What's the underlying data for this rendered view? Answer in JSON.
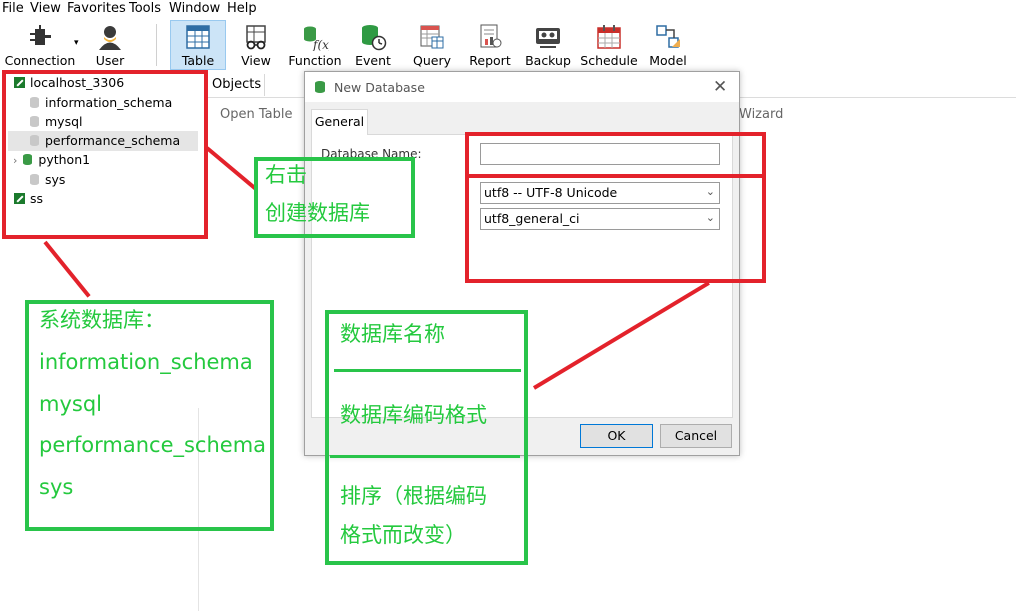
{
  "menu": [
    "File",
    "View",
    "Favorites",
    "Tools",
    "Window",
    "Help"
  ],
  "toolbar": [
    {
      "label": "Connection",
      "icon": "connection-icon"
    },
    {
      "label": "User",
      "icon": "user-icon"
    },
    {
      "label": "Table",
      "icon": "table-icon",
      "active": true
    },
    {
      "label": "View",
      "icon": "view-icon"
    },
    {
      "label": "Function",
      "icon": "function-icon"
    },
    {
      "label": "Event",
      "icon": "event-icon"
    },
    {
      "label": "Query",
      "icon": "query-icon"
    },
    {
      "label": "Report",
      "icon": "report-icon"
    },
    {
      "label": "Backup",
      "icon": "backup-icon"
    },
    {
      "label": "Schedule",
      "icon": "schedule-icon"
    },
    {
      "label": "Model",
      "icon": "model-icon"
    }
  ],
  "tree": {
    "connection": "localhost_3306",
    "databases": [
      "information_schema",
      "mysql",
      "performance_schema",
      "python1",
      "sys"
    ],
    "selected": "performance_schema",
    "other_connection": "ss"
  },
  "objects_panel": {
    "tab": "Objects",
    "open_table": "Open Table",
    "wizard": "Wizard"
  },
  "dialog": {
    "title": "New Database",
    "tab": "General",
    "db_name_label": "Database Name:",
    "db_name_value": "",
    "charset": "utf8 -- UTF-8 Unicode",
    "collation": "utf8_general_ci",
    "ok_label": "OK",
    "cancel_label": "Cancel"
  },
  "annotations": {
    "right_click_line1": "右击",
    "right_click_line2": "创建数据库",
    "system_db_title": "系统数据库：",
    "system_db_list": [
      "information_schema",
      "mysql",
      "performance_schema",
      "sys"
    ],
    "db_name_note": "数据库名称",
    "db_charset_note": "数据库编码格式",
    "sort_note_line1": "排序（根据编码",
    "sort_note_line2": "格式而改变）"
  },
  "colors": {
    "annotation_red": "#e3222b",
    "annotation_green": "#29c44a",
    "annotation_text_green": "#24c93e",
    "toolbar_active": "#cce4f7",
    "tree_selected": "#e5e5e5",
    "connection_green": "#1b7a2c"
  }
}
